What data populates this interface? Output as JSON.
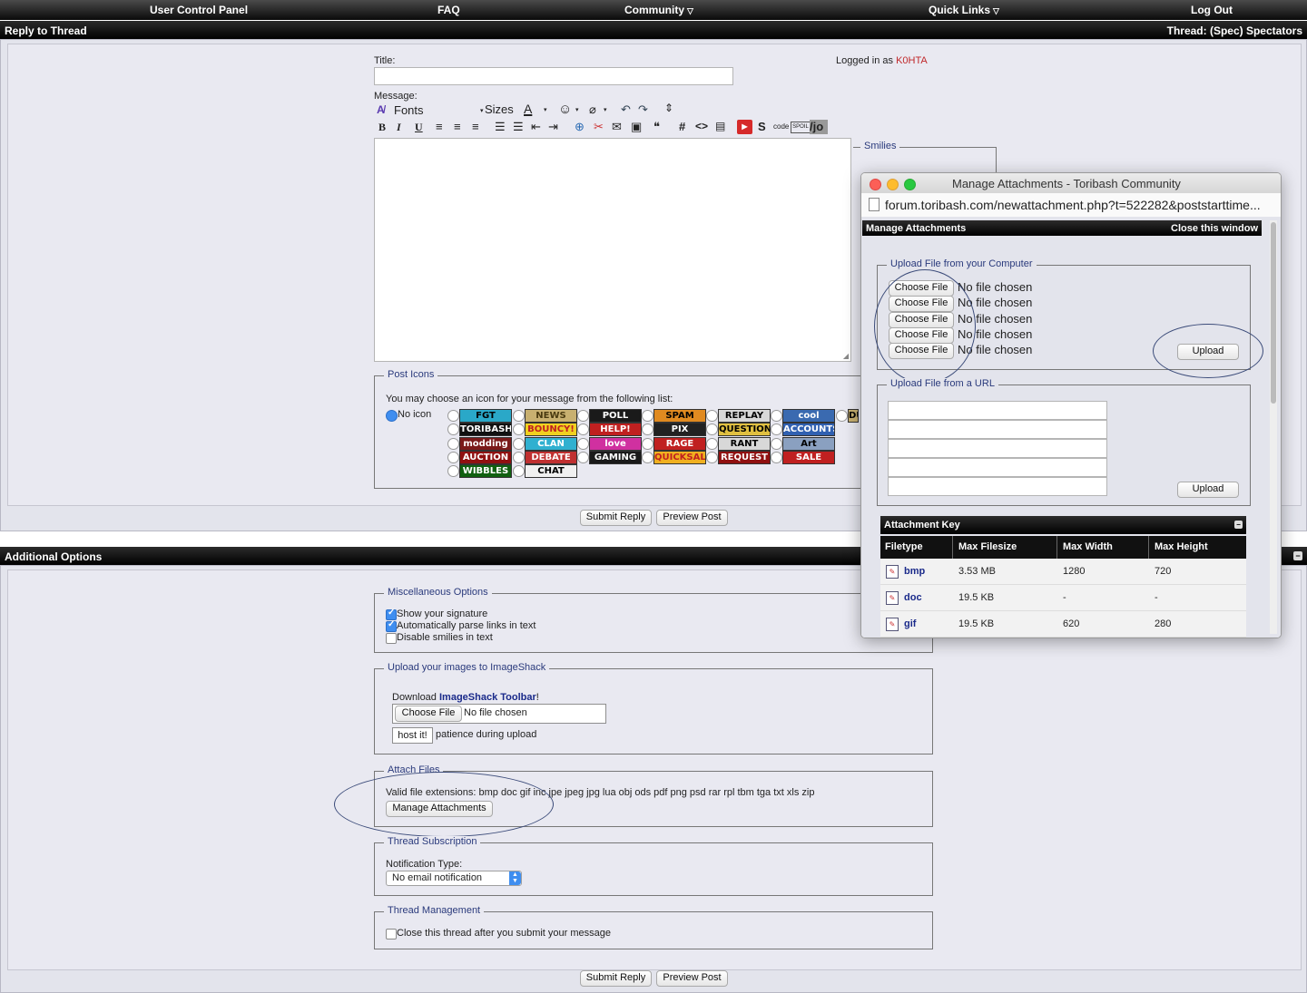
{
  "nav": {
    "ucp": "User Control Panel",
    "faq": "FAQ",
    "community": "Community",
    "quick_links": "Quick Links",
    "logout": "Log Out",
    "caret": "▽"
  },
  "reply": {
    "header_left": "Reply to Thread",
    "header_right": "Thread: (Spec) Spectators",
    "title_label": "Title:",
    "title_value": "",
    "logged_in_prefix": "Logged in as",
    "username": "K0HTA",
    "message_label": "Message:",
    "fonts_label": "Fonts",
    "sizes_label": "Sizes",
    "bold": "B",
    "italic": "I",
    "underline": "U",
    "code_label": "code",
    "spoil_label": "SPOIL",
    "jo_label": "/jo",
    "smilies_legend": "Smilies",
    "post_icons_legend": "Post Icons",
    "post_icons_hint": "You may choose an icon for your message from the following list:",
    "no_icon": "No icon",
    "icons": [
      "FGT",
      "NEWS",
      "POLL",
      "SPAM",
      "REPLAY",
      "cool",
      "DU",
      "TORIBASH",
      "BOUNCY!",
      "HELP!",
      "PIX",
      "QUESTION?",
      "ACCOUNTS",
      "modding",
      "CLAN",
      "love",
      "RAGE",
      "RANT",
      "Art",
      "AUCTION",
      "DEBATE",
      "GAMING",
      "QUICKSALE",
      "REQUEST",
      "SALE",
      "WIBBLES",
      "CHAT"
    ],
    "submit": "Submit Reply",
    "preview": "Preview Post"
  },
  "additional": {
    "header": "Additional Options",
    "misc_legend": "Miscellaneous Options",
    "show_signature": "Show your signature",
    "parse_links": "Automatically parse links in text",
    "disable_smilies": "Disable smilies in text",
    "imageshack_legend": "Upload your images to ImageShack",
    "download_prefix": "Download",
    "toolbar_link": "ImageShack Toolbar",
    "download_suffix": "!",
    "choose_file": "Choose File",
    "no_file": "No file chosen",
    "host_it": "host it!",
    "patience": "patience during upload",
    "attach_legend": "Attach Files",
    "valid_ext": "Valid file extensions: bmp doc gif inc jpe jpeg jpg lua obj ods pdf png psd rar rpl tbm tga txt xls zip",
    "manage_attachments": "Manage Attachments",
    "subscription_legend": "Thread Subscription",
    "notification_label": "Notification Type:",
    "notification_value": "No email notification",
    "management_legend": "Thread Management",
    "close_thread": "Close this thread after you submit your message",
    "submit": "Submit Reply",
    "preview": "Preview Post"
  },
  "popup": {
    "window_title": "Manage Attachments - Toribash Community",
    "url": "forum.toribash.com/newattachment.php?t=522282&poststarttime...",
    "header_left": "Manage Attachments",
    "header_right": "Close this window",
    "upload_computer_legend": "Upload File from your Computer",
    "choose_file": "Choose File",
    "no_file": "No file chosen",
    "upload": "Upload",
    "upload_url_legend": "Upload File from a URL",
    "key_header": "Attachment Key",
    "columns": [
      "Filetype",
      "Max Filesize",
      "Max Width",
      "Max Height"
    ],
    "rows": [
      {
        "type": "bmp",
        "size": "3.53 MB",
        "width": "1280",
        "height": "720"
      },
      {
        "type": "doc",
        "size": "19.5 KB",
        "width": "-",
        "height": "-"
      },
      {
        "type": "gif",
        "size": "19.5 KB",
        "width": "620",
        "height": "280"
      }
    ]
  },
  "colors": {
    "accent_blue": "#2a3a7c",
    "username_red": "#c0282a",
    "link_navy": "#1a2a8a"
  }
}
